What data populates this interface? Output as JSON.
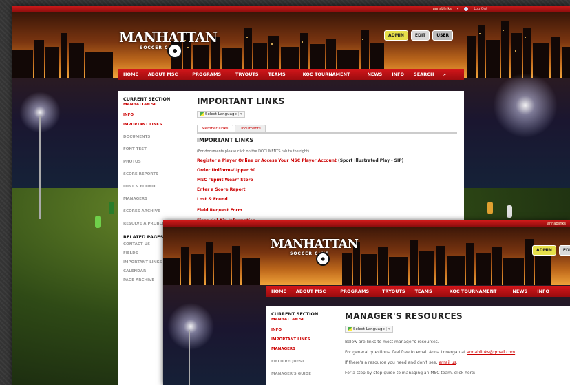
{
  "site": {
    "logo_top": "MANHATTAN",
    "logo_bottom": "SOCCER CLUB",
    "topbar_user": "annablinks",
    "topbar_logout": "Log Out",
    "admin_badge": "ADMIN",
    "edit_badge": "EDIT",
    "user_badge": "USER",
    "nav": [
      "HOME",
      "ABOUT MSC",
      "PROGRAMS",
      "TRYOUTS",
      "TEAMS",
      "KOC TOURNAMENT",
      "NEWS",
      "INFO",
      "SEARCH"
    ],
    "search_icon": "search-icon",
    "colors": {
      "brand_red": "#c4141a",
      "link_red": "#cc0000"
    }
  },
  "important_links_page": {
    "sidebar": {
      "current_section": "CURRENT SECTION",
      "section_name": "MANHATTAN SC",
      "items_red": [
        "INFO",
        "IMPORTANT LINKS"
      ],
      "items": [
        "DOCUMENTS",
        "FONT TEST",
        "PHOTOS",
        "SCORE REPORTS",
        "LOST & FOUND",
        "MANAGERS",
        "SCORES ARCHIVE",
        "RESOLVE A PROBLEM"
      ],
      "related_head": "RELATED PAGES",
      "related": [
        "CONTACT US",
        "FIELDS",
        "IMPORTANT LINKS",
        "CALENDAR",
        "PAGE ARCHIVE"
      ]
    },
    "title": "IMPORTANT LINKS",
    "select_language": "Select Language",
    "tabs": [
      "Member Links",
      "Documents"
    ],
    "section_title": "IMPORTANT LINKS",
    "note": "(For documents please click on the DOCUMENTS tab to the right)",
    "links": [
      {
        "text": "Register a Player Online or Access Your MSC Player Account",
        "suffix": " (Sport Illustrated Play - SIP)"
      },
      {
        "text": "Order Uniforms/Upper 90",
        "suffix": ""
      },
      {
        "text": "MSC \"Spirit Wear\" Store",
        "suffix": ""
      },
      {
        "text": "Enter a Score Report",
        "suffix": ""
      },
      {
        "text": "Lost & Found",
        "suffix": ""
      },
      {
        "text": "Field Request Form",
        "suffix": ""
      },
      {
        "text": "Financial Aid Information",
        "suffix": ""
      }
    ]
  },
  "managers_page": {
    "sidebar": {
      "current_section": "CURRENT SECTION",
      "section_name": "MANHATTAN SC",
      "items_red": [
        "INFO",
        "IMPORTANT LINKS",
        "MANAGERS"
      ],
      "items": [
        "FIELD REQUEST",
        "MANAGER'S GUIDE"
      ]
    },
    "nav": [
      "HOME",
      "ABOUT MSC",
      "PROGRAMS",
      "TRYOUTS",
      "TEAMS",
      "KOC TOURNAMENT",
      "NEWS",
      "INFO"
    ],
    "title": "MANAGER'S RESOURCES",
    "select_language": "Select Language",
    "p1": "Below are links to most manager's resources.",
    "p2_pre": "For general questions, feel free to email Anna Lonergan at ",
    "p2_link": "annablinks@gmail.com",
    "p3_pre": "If there's a resource you need and don't see, ",
    "p3_link": "email us",
    "p3_post": ".",
    "p4": "For a step-by-step guide to managing an MSC team, click here:"
  }
}
